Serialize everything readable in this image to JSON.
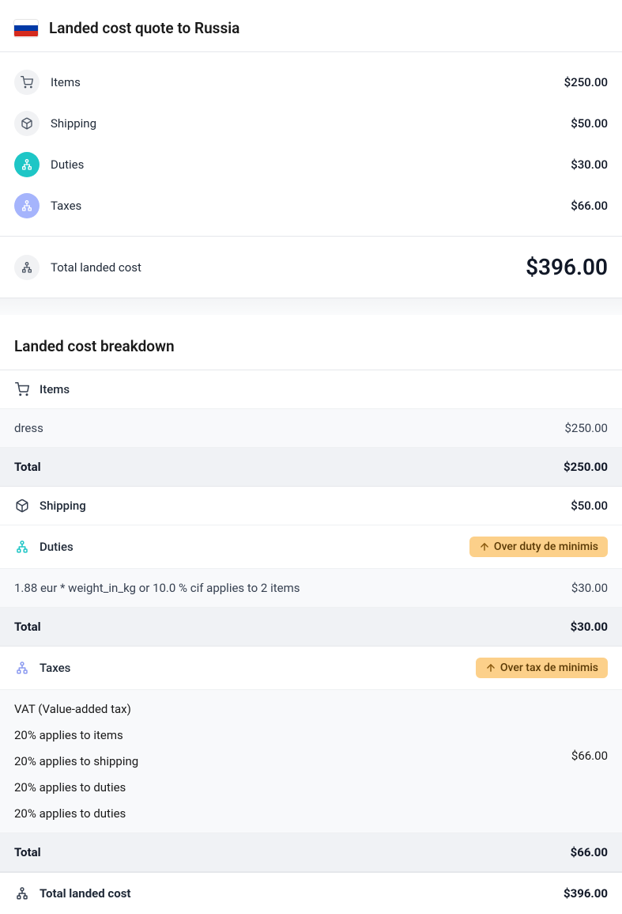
{
  "header": {
    "title": "Landed cost quote to Russia"
  },
  "summary": [
    {
      "label": "Items",
      "amount": "$250.00",
      "icon": "cart",
      "iconStyle": "grey"
    },
    {
      "label": "Shipping",
      "amount": "$50.00",
      "icon": "box",
      "iconStyle": "grey"
    },
    {
      "label": "Duties",
      "amount": "$30.00",
      "icon": "hierarchy",
      "iconStyle": "teal"
    },
    {
      "label": "Taxes",
      "amount": "$66.00",
      "icon": "hierarchy",
      "iconStyle": "blue"
    }
  ],
  "total": {
    "label": "Total landed cost",
    "amount": "$396.00"
  },
  "breakdown": {
    "title": "Landed cost breakdown",
    "items": {
      "label": "Items",
      "lines": [
        {
          "label": "dress",
          "amount": "$250.00"
        }
      ],
      "total_label": "Total",
      "total_amount": "$250.00"
    },
    "shipping": {
      "label": "Shipping",
      "amount": "$50.00"
    },
    "duties": {
      "label": "Duties",
      "badge": "Over duty de minimis",
      "lines": [
        {
          "label": "1.88 eur * weight_in_kg or 10.0 % cif applies to 2 items",
          "amount": "$30.00"
        }
      ],
      "total_label": "Total",
      "total_amount": "$30.00"
    },
    "taxes": {
      "label": "Taxes",
      "badge": "Over tax de minimis",
      "subtitle": "VAT (Value-added tax)",
      "details": [
        "20% applies to items",
        "20% applies to shipping",
        "20% applies to duties",
        "20% applies to duties"
      ],
      "amount": "$66.00",
      "total_label": "Total",
      "total_amount": "$66.00"
    },
    "grand_total": {
      "label": "Total landed cost",
      "amount": "$396.00"
    }
  }
}
